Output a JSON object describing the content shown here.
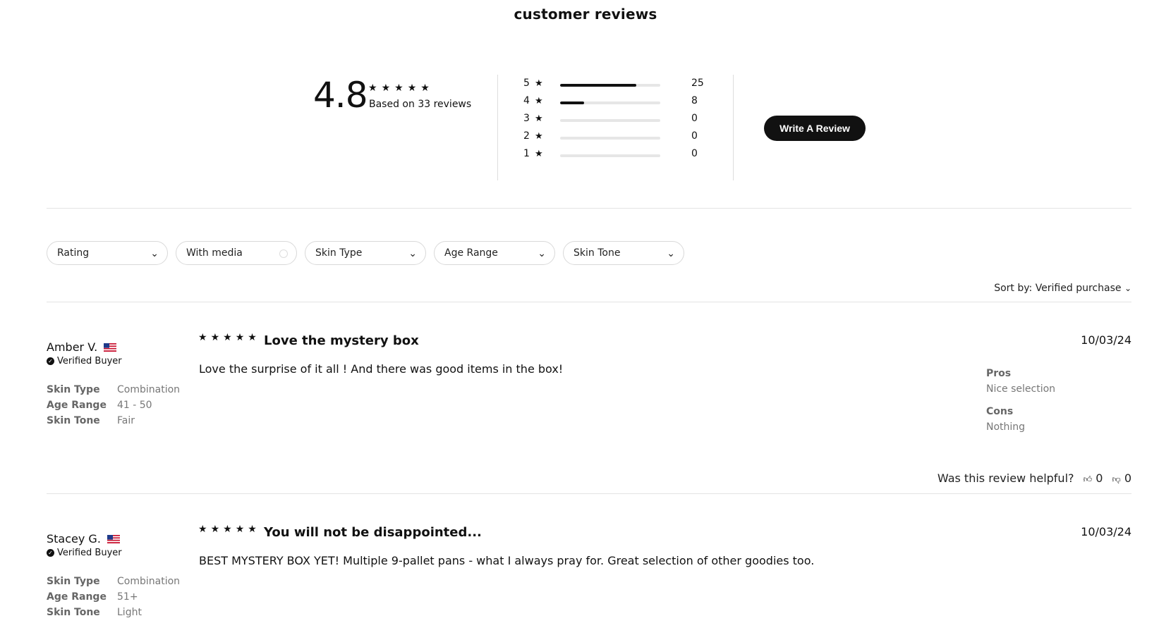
{
  "page": {
    "title": "customer reviews"
  },
  "summary": {
    "average": "4.8",
    "based_on": "Based on 33 reviews",
    "star_glyph": "★★★★★",
    "distribution": [
      {
        "stars": "5",
        "count": "25",
        "fraction": 0.758
      },
      {
        "stars": "4",
        "count": "8",
        "fraction": 0.242
      },
      {
        "stars": "3",
        "count": "0",
        "fraction": 0
      },
      {
        "stars": "2",
        "count": "0",
        "fraction": 0
      },
      {
        "stars": "1",
        "count": "0",
        "fraction": 0
      }
    ],
    "write_review": "Write A Review"
  },
  "filters": [
    {
      "label": "Rating",
      "icon": "chevron-down-icon"
    },
    {
      "label": "With media",
      "icon": "toggle-icon"
    },
    {
      "label": "Skin Type",
      "icon": "chevron-down-icon"
    },
    {
      "label": "Age Range",
      "icon": "chevron-down-icon"
    },
    {
      "label": "Skin Tone",
      "icon": "chevron-down-icon"
    }
  ],
  "sort": {
    "label": "Sort by:",
    "value": "Verified purchase"
  },
  "reviews": [
    {
      "name": "Amber V.",
      "verified": "Verified Buyer",
      "attributes": [
        {
          "key": "Skin Type",
          "value": "Combination"
        },
        {
          "key": "Age Range",
          "value": "41 - 50"
        },
        {
          "key": "Skin Tone",
          "value": "Fair"
        }
      ],
      "rating": 5,
      "title": "Love the mystery box",
      "body": "Love the surprise of it all ! And there was good items in the box!",
      "date": "10/03/24",
      "pros_label": "Pros",
      "pros": "Nice selection",
      "cons_label": "Cons",
      "cons": "Nothing",
      "helpful_label": "Was this review helpful?",
      "up": "0",
      "down": "0"
    },
    {
      "name": "Stacey G.",
      "verified": "Verified Buyer",
      "attributes": [
        {
          "key": "Skin Type",
          "value": "Combination"
        },
        {
          "key": "Age Range",
          "value": "51+"
        },
        {
          "key": "Skin Tone",
          "value": "Light"
        }
      ],
      "rating": 5,
      "title": "You will not be disappointed...",
      "body": "BEST MYSTERY BOX YET! Multiple 9-pallet pans - what I always pray for. Great selection of other goodies too.",
      "date": "10/03/24"
    }
  ]
}
